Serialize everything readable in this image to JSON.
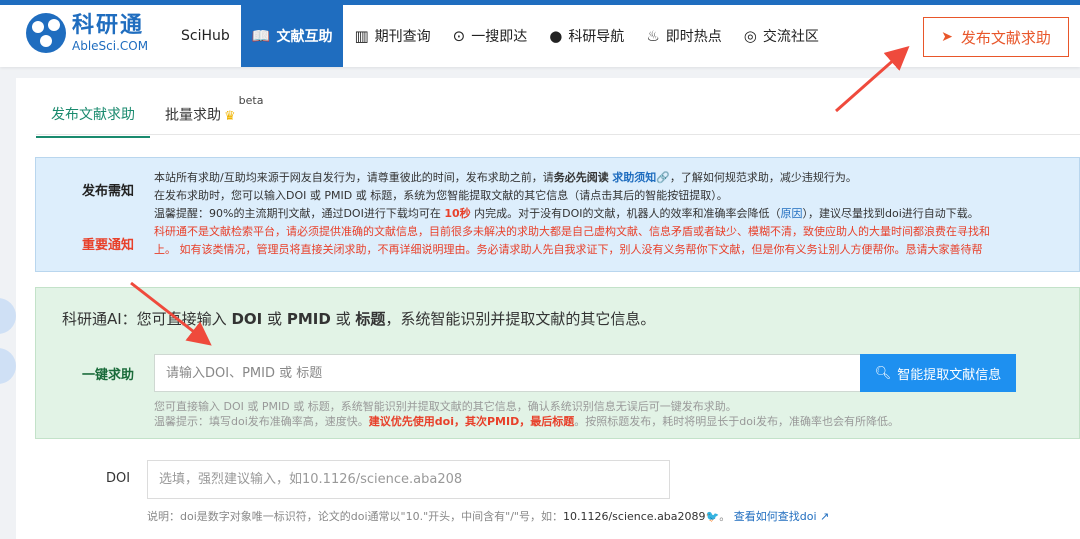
{
  "brand": {
    "name_cn": "科研通",
    "name_en": "AbleSci.COM"
  },
  "nav": {
    "items": [
      {
        "label": "SciHub",
        "icon": ""
      },
      {
        "label": "文献互助",
        "icon": "book-icon"
      },
      {
        "label": "期刊查询",
        "icon": "journal-icon"
      },
      {
        "label": "一搜即达",
        "icon": "search-icon"
      },
      {
        "label": "科研导航",
        "icon": "globe-icon"
      },
      {
        "label": "即时热点",
        "icon": "fire-icon"
      },
      {
        "label": "交流社区",
        "icon": "chat-icon"
      }
    ],
    "publish_label": "发布文献求助"
  },
  "tabs": [
    {
      "label": "发布文献求助"
    },
    {
      "label": "批量求助",
      "sup": "beta"
    }
  ],
  "notice": {
    "label1": "发布需知",
    "label2": "重要通知",
    "line1_a": "本站所有求助/互助均来源于网友自发行为，请尊重彼此的时间，发布求助之前，请",
    "line1_b": "务必先阅读",
    "line1_link": "求助须知🔗",
    "line1_c": "，了解如何规范求助，减少违规行为。",
    "line2": "在发布求助时，您可以输入DOI 或 PMID 或 标题，系统为您智能提取文献的其它信息（请点击其后的智能按钮提取）。",
    "line3_a": "温馨提醒：90%的主流期刊文献，通过DOI进行下载均可在",
    "line3_b": "10秒",
    "line3_c": "内完成。对于没有DOI的文献，机器人的效率和准确率会降低（",
    "line3_link": "原因",
    "line3_d": "），建议尽量找到doi进行自动下载。",
    "line4": "科研通不是文献检索平台，请必须提供准确的文献信息，目前很多未解决的求助大都是自己虚构文献、信息矛盾或者缺少、模糊不清，致使应助人的大量时间都浪费在寻找和",
    "line5": "上。 如有该类情况，管理员将直接关闭求助，不再详细说明理由。务必请求助人先自我求证下，别人没有义务帮你下文献，但是你有义务让别人方便帮你。恳请大家善待帮"
  },
  "ai": {
    "title_prefix": "科研通AI：您可直接输入",
    "title_doi": "DOI",
    "title_or1": "或",
    "title_pmid": "PMID",
    "title_or2": "或",
    "title_kw": "标题",
    "title_suffix": "，系统智能识别并提取文献的其它信息。",
    "label": "一键求助",
    "placeholder": "请输入DOI、PMID 或 标题",
    "button": "智能提取文献信息",
    "hint1": "您可直接输入 DOI 或 PMID 或 标题，系统智能识别并提取文献的其它信息，确认系统识别信息无误后可一键发布求助。",
    "hint2_a": "温馨提示：填写doi发布准确率高，速度快。",
    "hint2_b": "建议优先使用doi，其次PMID，最后标题",
    "hint2_c": "。按照标题发布，耗时将明显长于doi发布，准确率也会有所降低。"
  },
  "doi": {
    "label": "DOI",
    "placeholder": "选填，强烈建议输入，如10.1126/science.aba208",
    "hint_a": "说明：doi是数字对象唯一标识符，论文的doi通常以\"10.\"开头，中间含有\"/\"号，如：",
    "hint_example": "10.1126/science.aba2089",
    "hint_link": "查看如何查找doi"
  },
  "colors": {
    "brand_blue": "#1f6dbf",
    "accent_orange": "#e8562a",
    "green": "#1a8a6e"
  }
}
